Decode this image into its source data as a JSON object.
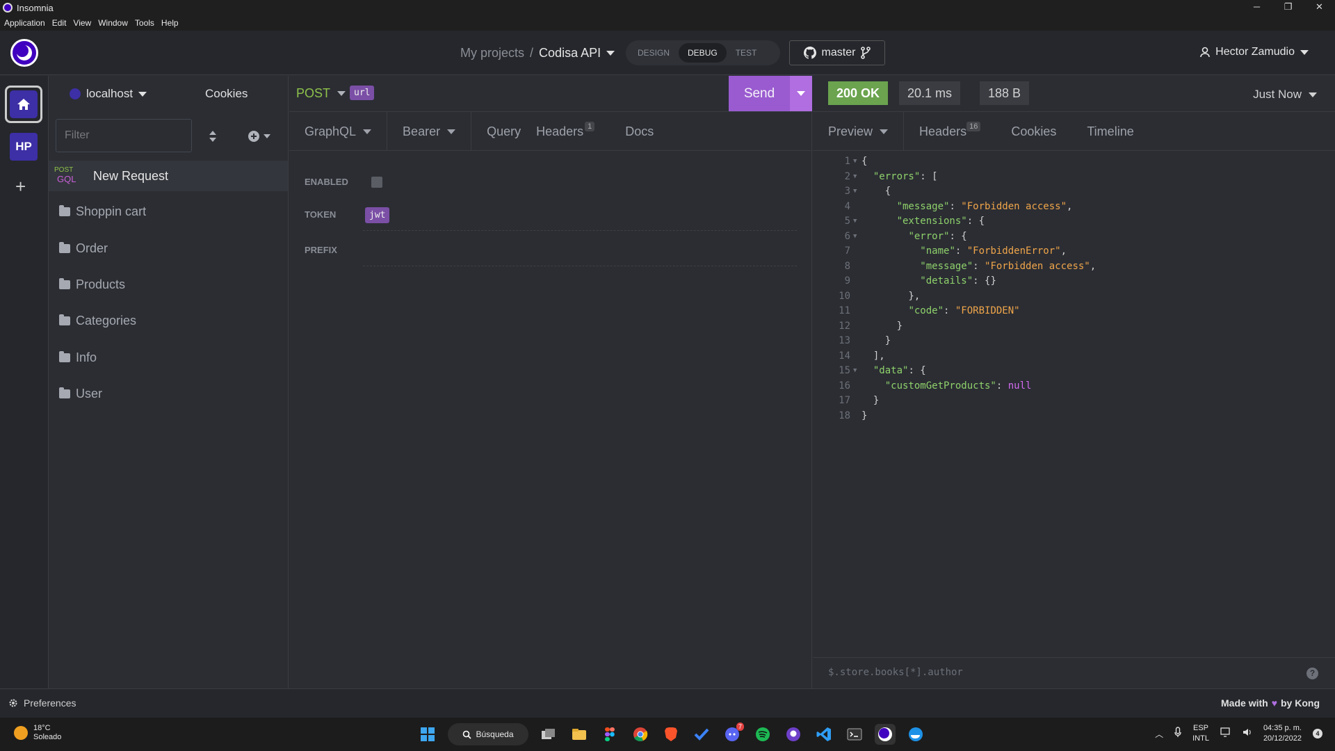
{
  "window": {
    "title": "Insomnia",
    "controls": [
      "─",
      "❐",
      "✕"
    ]
  },
  "menu": [
    "Application",
    "Edit",
    "View",
    "Window",
    "Tools",
    "Help"
  ],
  "header": {
    "projects_label": "My projects",
    "separator": "/",
    "api_name": "Codisa API",
    "modes": [
      "DESIGN",
      "DEBUG",
      "TEST"
    ],
    "active_mode": "DEBUG",
    "branch": "master",
    "user": "Hector Zamudio"
  },
  "rail": {
    "hp_label": "HP",
    "add": "+"
  },
  "sidebar": {
    "environment": "localhost",
    "cookies": "Cookies",
    "filter_placeholder": "Filter",
    "request": {
      "method": "POST",
      "type": "GQL",
      "name": "New Request"
    },
    "folders": [
      "Shoppin cart",
      "Order",
      "Products",
      "Categories",
      "Info",
      "User"
    ]
  },
  "request": {
    "method": "POST",
    "url_tag": "url",
    "send_label": "Send",
    "tabs": [
      {
        "label": "GraphQL",
        "dropdown": true,
        "badge": ""
      },
      {
        "label": "Bearer",
        "dropdown": true,
        "badge": ""
      },
      {
        "label": "Query",
        "dropdown": false,
        "badge": ""
      },
      {
        "label": "Headers",
        "dropdown": false,
        "badge": "1"
      },
      {
        "label": "Docs",
        "dropdown": false,
        "badge": ""
      }
    ],
    "auth": {
      "enabled_label": "ENABLED",
      "token_label": "TOKEN",
      "token_value": "jwt",
      "prefix_label": "PREFIX"
    }
  },
  "response": {
    "status": "200 OK",
    "time": "20.1 ms",
    "size": "188 B",
    "when": "Just Now",
    "tabs": [
      {
        "label": "Preview",
        "dropdown": true,
        "badge": ""
      },
      {
        "label": "Headers",
        "dropdown": false,
        "badge": "16"
      },
      {
        "label": "Cookies",
        "dropdown": false,
        "badge": ""
      },
      {
        "label": "Timeline",
        "dropdown": false,
        "badge": ""
      }
    ],
    "filter_placeholder": "$.store.books[*].author",
    "help": "?"
  },
  "footer": {
    "preferences": "Preferences",
    "made_with": "Made with",
    "by": "by Kong"
  },
  "taskbar": {
    "temp": "18°C",
    "weather": "Soleado",
    "search": "Búsqueda",
    "lang1": "ESP",
    "lang2": "INTL",
    "time": "04:35 p. m.",
    "date": "20/12/2022",
    "notifications": "4",
    "discord_badge": "7"
  },
  "colors": {
    "accent": "#9a5bd0",
    "status_ok": "#6ba34e",
    "method_post": "#8ec24a"
  }
}
